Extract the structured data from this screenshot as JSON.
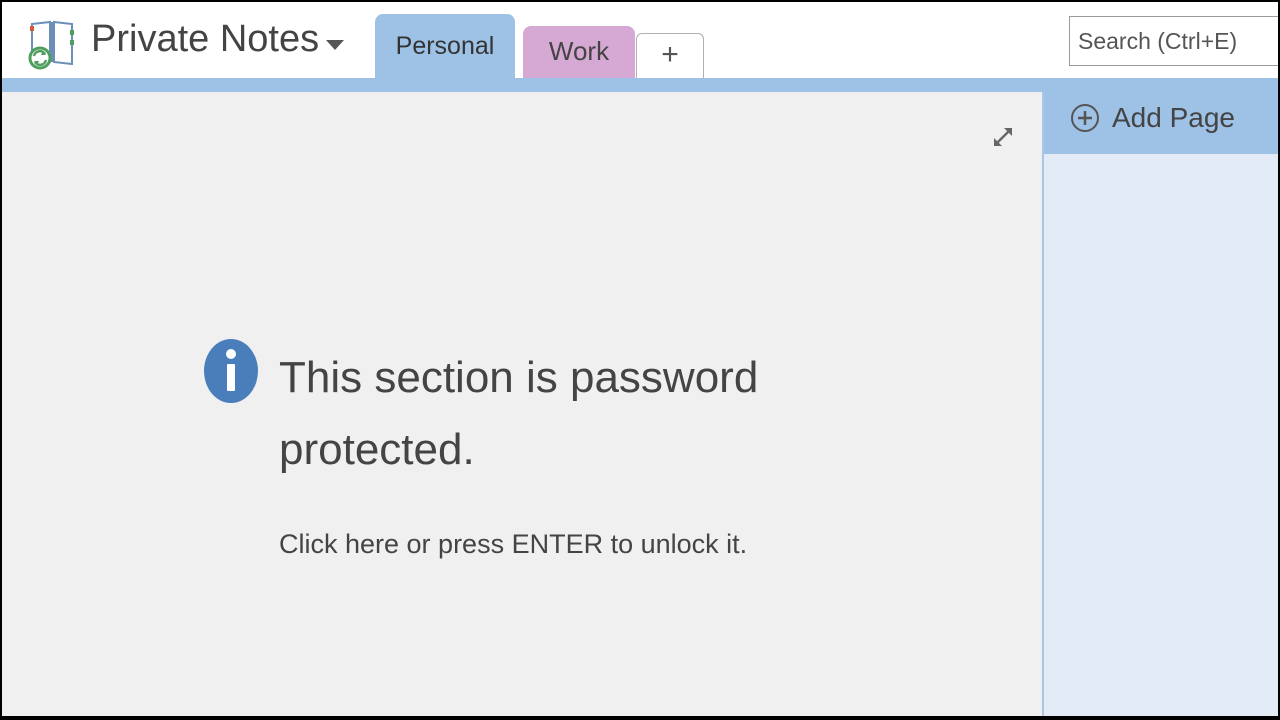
{
  "header": {
    "notebook_name": "Private Notes",
    "notebook_icon": "notebook-sync-icon",
    "dropdown_icon": "caret-down-icon",
    "tabs": [
      {
        "label": "Personal",
        "color": "#9ec1e6",
        "active": true
      },
      {
        "label": "Work",
        "color": "#d6a8d4",
        "active": false
      }
    ],
    "add_tab_label": "+",
    "search": {
      "placeholder": "Search (Ctrl+E)",
      "value": ""
    }
  },
  "main": {
    "info_icon": "info-icon",
    "expand_icon": "expand-arrows-icon",
    "locked_message": "This section is password protected.",
    "unlock_hint": "Click here or press ENTER to unlock it."
  },
  "page_list": {
    "add_page_label": "Add Page",
    "add_page_icon": "plus-circle-icon"
  },
  "colors": {
    "accent_blue": "#9ec1e6",
    "work_tab": "#d6a8d4",
    "info_icon_blue": "#4a7ebb",
    "page_background": "#f0f0f0",
    "page_list_background": "#e3ecf6"
  }
}
